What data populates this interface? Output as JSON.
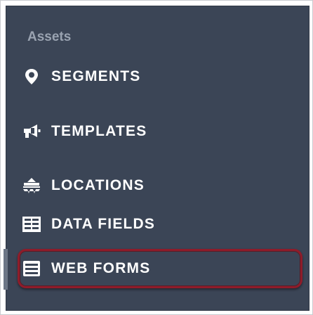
{
  "sidebar": {
    "section_title": "Assets",
    "items": [
      {
        "label": "SEGMENTS",
        "icon": "map-pin-icon",
        "active": false
      },
      {
        "label": "TEMPLATES",
        "icon": "megaphone-icon",
        "active": false
      },
      {
        "label": "LOCATIONS",
        "icon": "store-icon",
        "active": false
      },
      {
        "label": "DATA FIELDS",
        "icon": "table-icon",
        "active": false
      },
      {
        "label": "WEB FORMS",
        "icon": "web-form-icon",
        "active": true
      }
    ],
    "colors": {
      "panel_bg": "#3b4556",
      "section_title": "#9aa3b1",
      "label": "#ffffff",
      "active_outline": "#8e1c2a"
    }
  }
}
